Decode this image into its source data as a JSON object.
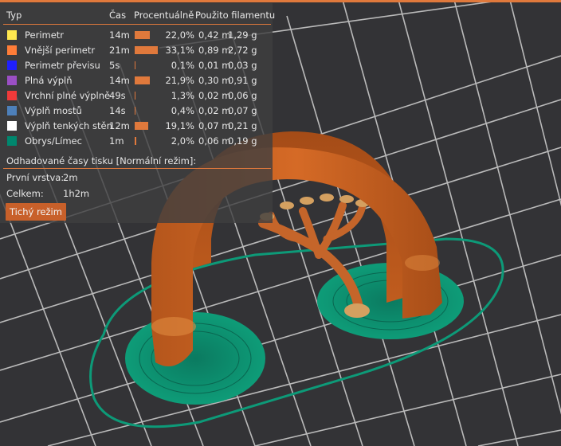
{
  "legend": {
    "headers": {
      "type": "Typ",
      "time": "Čas",
      "percent": "Procentuálně",
      "filament": "Použito filamentu"
    },
    "rows": [
      {
        "label": "Perimetr",
        "time": "14m",
        "percent": "22,0%",
        "ratio": 0.22,
        "length": "0,42 m",
        "weight": "1,29 g",
        "color": "#ffe84f"
      },
      {
        "label": "Vnější perimetr",
        "time": "21m",
        "percent": "33,1%",
        "ratio": 0.331,
        "length": "0,89 m",
        "weight": "2,72 g",
        "color": "#ff7d38"
      },
      {
        "label": "Perimetr převisu",
        "time": "5s",
        "percent": "0,1%",
        "ratio": 0.001,
        "length": "0,01 m",
        "weight": "0,03 g",
        "color": "#1f1fff"
      },
      {
        "label": "Plná výplň",
        "time": "14m",
        "percent": "21,9%",
        "ratio": 0.219,
        "length": "0,30 m",
        "weight": "0,91 g",
        "color": "#9b4fc4"
      },
      {
        "label": "Vrchní plné výplně",
        "time": "49s",
        "percent": "1,3%",
        "ratio": 0.013,
        "length": "0,02 m",
        "weight": "0,06 g",
        "color": "#f03a3a"
      },
      {
        "label": "Výplň mostů",
        "time": "14s",
        "percent": "0,4%",
        "ratio": 0.004,
        "length": "0,02 m",
        "weight": "0,07 g",
        "color": "#4d80ba"
      },
      {
        "label": "Výplň tenkých stěn",
        "time": "12m",
        "percent": "19,1%",
        "ratio": 0.191,
        "length": "0,07 m",
        "weight": "0,21 g",
        "color": "#ffffff"
      },
      {
        "label": "Obrys/Límec",
        "time": "1m",
        "percent": "2,0%",
        "ratio": 0.02,
        "length": "0,06 m",
        "weight": "0,19 g",
        "color": "#00876e"
      }
    ],
    "estimate_title": "Odhadované časy tisku [Normální režim]:",
    "first_layer_label": "První vrstva:",
    "first_layer_value": "2m",
    "total_label": "Celkem:",
    "total_value": "1h2m",
    "mode_button": "Tichý režim"
  },
  "colors": {
    "accent": "#e0793c",
    "background": "#333336",
    "model": "#c8621f",
    "skirt": "#0d9a78"
  }
}
